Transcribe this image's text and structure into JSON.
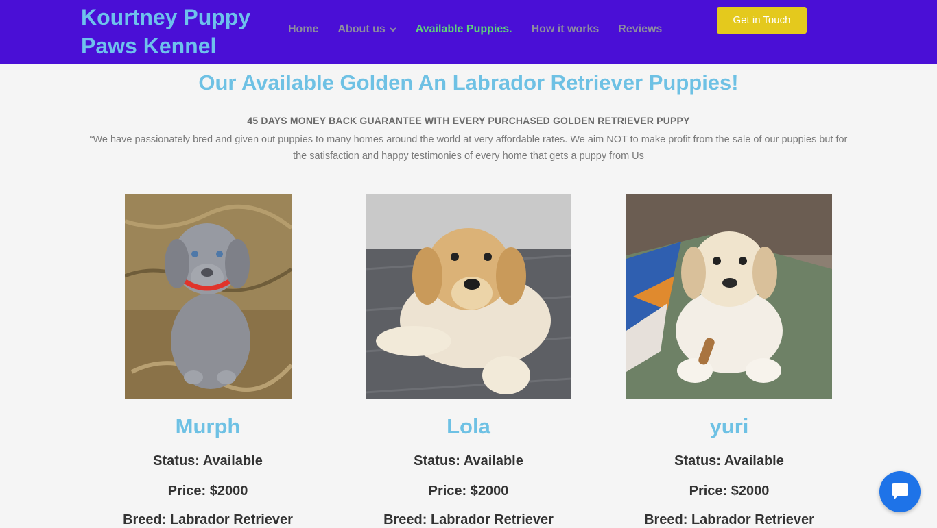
{
  "site": {
    "logo": "Kourtney Puppy Paws Kennel"
  },
  "nav": {
    "items": [
      {
        "label": "Home"
      },
      {
        "label": "About us"
      },
      {
        "label": "Available Puppies."
      },
      {
        "label": "How it works"
      },
      {
        "label": "Reviews"
      }
    ],
    "cta": "Get in Touch"
  },
  "main": {
    "title": "Our Available Golden An Labrador Retriever Puppies!",
    "guarantee": "45 DAYS MONEY BACK GUARANTEE WITH EVERY PURCHASED  GOLDEN RETRIEVER PUPPY",
    "mission": "“We have passionately bred and given out puppies to many homes around the world at very affordable rates. We aim NOT to make profit from the sale of our puppies but for the satisfaction and happy testimonies of every home that gets a puppy from Us"
  },
  "puppies": [
    {
      "name": "Murph",
      "status": "Status: Available",
      "price": "Price: $2000",
      "breed": "Breed: Labrador Retriever",
      "photo": "silver-labrador-puppy-on-grass"
    },
    {
      "name": "Lola",
      "status": "Status: Available",
      "price": "Price: $2000",
      "breed": "Breed: Labrador Retriever",
      "photo": "yellow-labrador-puppy-on-deck"
    },
    {
      "name": "yuri",
      "status": "Status: Available",
      "price": "Price: $2000",
      "breed": "Breed: Labrador Retriever",
      "photo": "cream-labrador-puppy-on-bed"
    }
  ],
  "colors": {
    "header_bg": "#4a0fd6",
    "accent_blue": "#6ec1e4",
    "active_nav": "#5fd27a",
    "cta_yellow": "#e4c91d",
    "chat_blue": "#1e73e8"
  },
  "icons": {
    "nav_dropdown": "chevron-down-icon",
    "chat": "chat-bubble-icon"
  }
}
